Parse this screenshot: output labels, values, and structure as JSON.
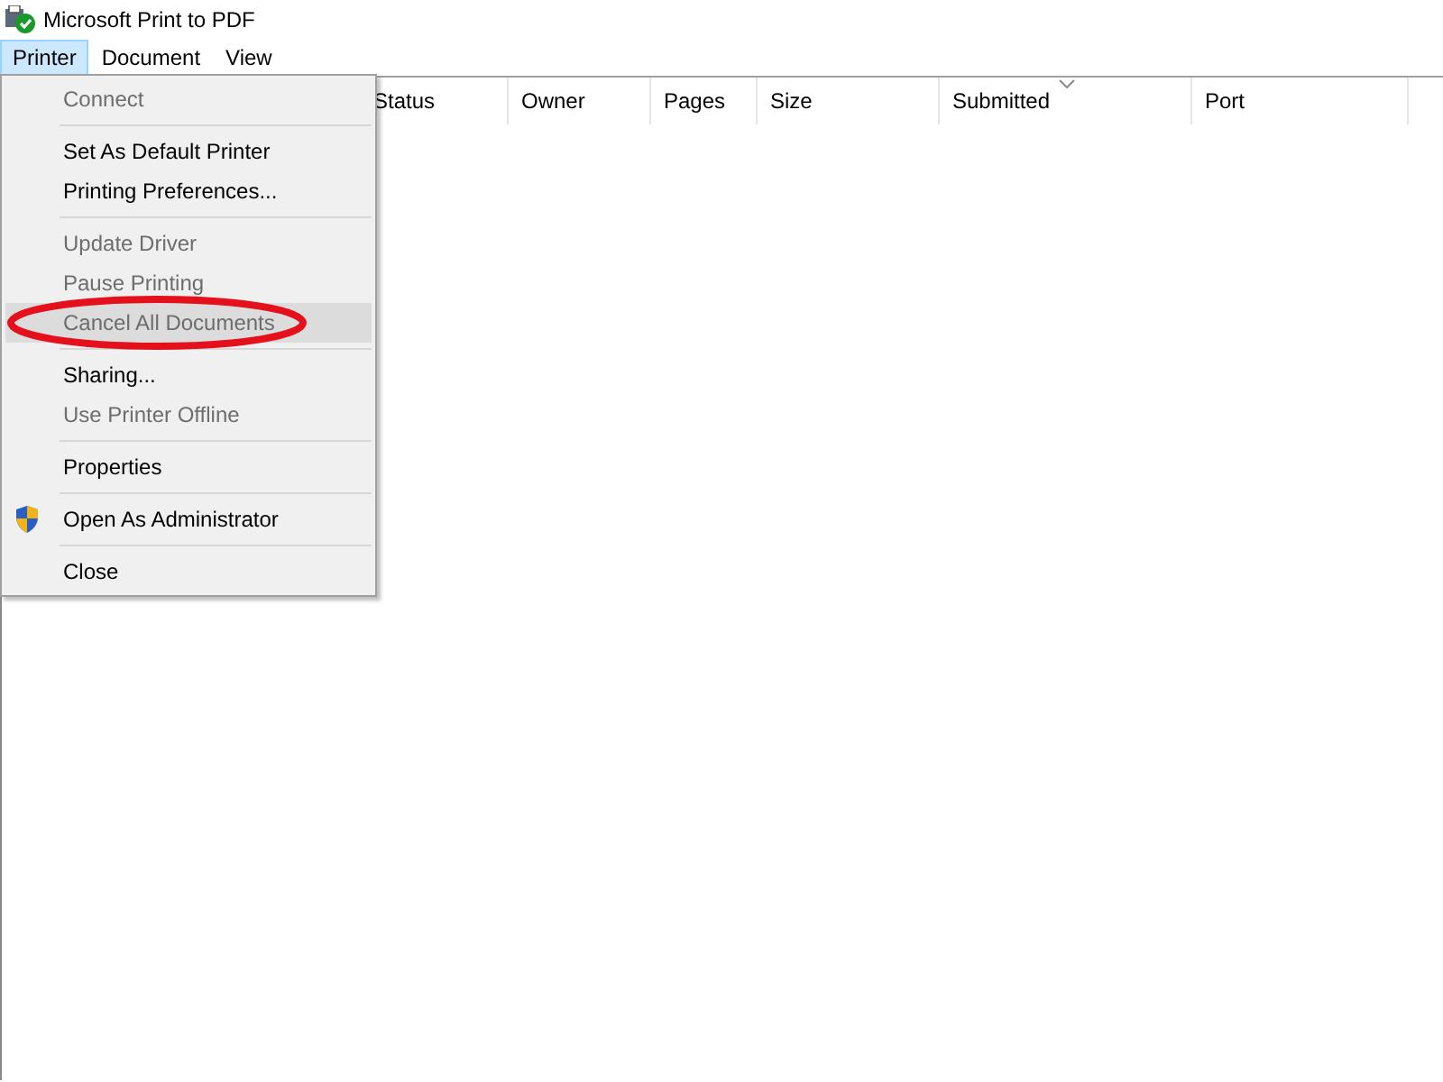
{
  "window": {
    "title": "Microsoft Print to PDF"
  },
  "menubar": [
    {
      "label": "Printer",
      "selected": true
    },
    {
      "label": "Document",
      "selected": false
    },
    {
      "label": "View",
      "selected": false
    }
  ],
  "columns": [
    {
      "label": "Status",
      "sorted": false
    },
    {
      "label": "Owner",
      "sorted": false
    },
    {
      "label": "Pages",
      "sorted": false
    },
    {
      "label": "Size",
      "sorted": false
    },
    {
      "label": "Submitted",
      "sorted": true
    },
    {
      "label": "Port",
      "sorted": false
    }
  ],
  "menu": [
    {
      "kind": "item",
      "label": "Connect",
      "disabled": true,
      "selected": false
    },
    {
      "kind": "separator"
    },
    {
      "kind": "item",
      "label": "Set As Default Printer",
      "disabled": false,
      "selected": false
    },
    {
      "kind": "item",
      "label": "Printing Preferences...",
      "disabled": false,
      "selected": false
    },
    {
      "kind": "separator"
    },
    {
      "kind": "item",
      "label": "Update Driver",
      "disabled": true,
      "selected": false
    },
    {
      "kind": "item",
      "label": "Pause Printing",
      "disabled": true,
      "selected": false
    },
    {
      "kind": "item",
      "label": "Cancel All Documents",
      "disabled": true,
      "selected": true,
      "circled": true
    },
    {
      "kind": "separator"
    },
    {
      "kind": "item",
      "label": "Sharing...",
      "disabled": false,
      "selected": false
    },
    {
      "kind": "item",
      "label": "Use Printer Offline",
      "disabled": true,
      "selected": false
    },
    {
      "kind": "separator"
    },
    {
      "kind": "item",
      "label": "Properties",
      "disabled": false,
      "selected": false
    },
    {
      "kind": "separator"
    },
    {
      "kind": "shield-item",
      "label": "Open As Administrator",
      "disabled": false,
      "selected": false
    },
    {
      "kind": "separator"
    },
    {
      "kind": "item",
      "label": "Close",
      "disabled": false,
      "selected": false
    }
  ]
}
